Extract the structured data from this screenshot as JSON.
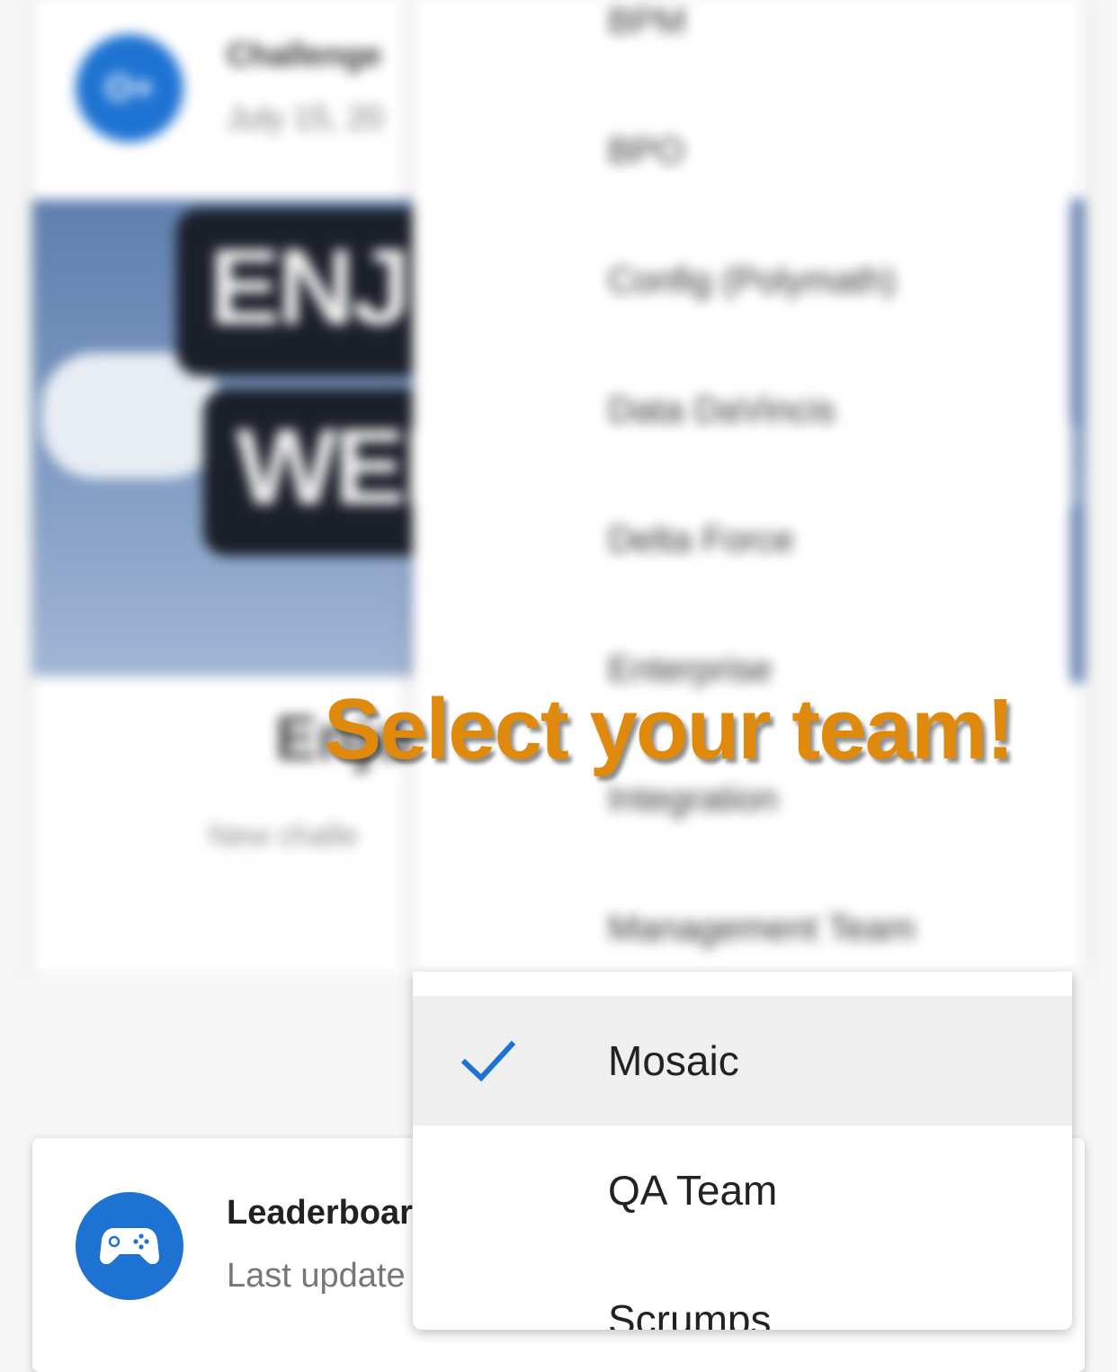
{
  "challenge_card": {
    "title": "Challenge",
    "date": "July 15, 20",
    "avatar_initials": "O+",
    "image_sign_line1": "ENJ",
    "image_sign_line2": "WEE",
    "heading": "Enjo",
    "subtitle": "New challe"
  },
  "team_menu": {
    "blurred_items": [
      "BPM",
      "BPO",
      "Config (Polymath)",
      "Data DaVincis",
      "Delta Force",
      "Enterprise",
      "Integration",
      "Management Team"
    ],
    "selected_item": "Mosaic",
    "items": [
      {
        "label": "Mosaic",
        "selected": true
      },
      {
        "label": "QA Team",
        "selected": false
      },
      {
        "label": "Scrumps",
        "selected": false
      }
    ],
    "check_color": "#1e73d2"
  },
  "overlay": {
    "title": "Select your team!",
    "color": "#e08a0d"
  },
  "leaderboard_card": {
    "title": "Leaderboar",
    "subtitle": "Last update",
    "icon": "gamepad-icon"
  },
  "colors": {
    "brand_blue": "#1e73d2",
    "selected_row_bg": "#efefef"
  }
}
